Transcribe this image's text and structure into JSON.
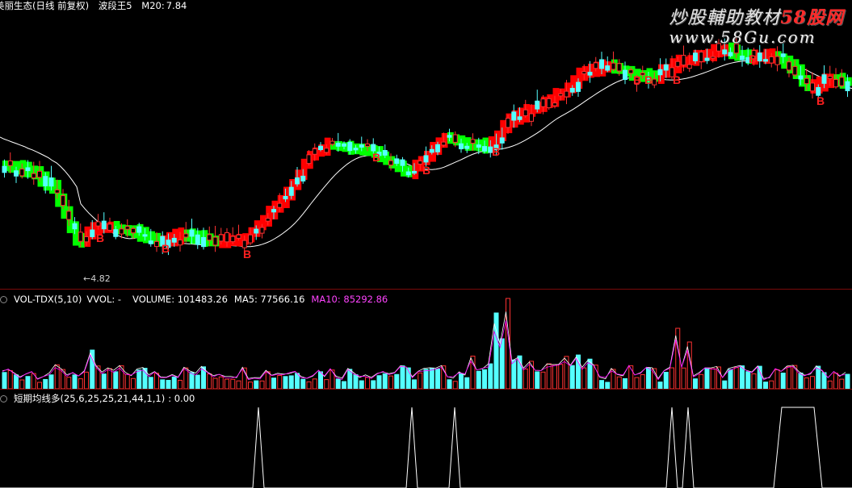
{
  "main_header": {
    "title": "美丽生态(日线 前复权)",
    "indicator": "波段王5",
    "ma_label": "M20:",
    "ma_value": "7.84"
  },
  "watermark": {
    "line1": "炒股輔助教材",
    "line1_accent": "58股网",
    "line2": "www.58Gu.com"
  },
  "price_annotation": {
    "low_label": "4.82"
  },
  "buy_marker_label": "B",
  "volume_header": {
    "name": "VOL-TDX(5,10)",
    "vvol": "VVOL: -",
    "volume": "VOLUME: 101483.26",
    "ma5": "MA5: 77566.16",
    "ma10": "MA10: 85292.86"
  },
  "indicator_header": {
    "name": "短期均线多(25,6,25,25,21,44,1,1)",
    "value": ": 0.00"
  },
  "colors": {
    "background": "#000000",
    "up_candle": "#ff3232",
    "down_candle": "#54ffff",
    "ribbon_up": "#ff0000",
    "ribbon_down": "#00ff00",
    "ma_line": "#ffffff",
    "ma10_line": "#ff00ff",
    "separator": "#7a0a0a"
  }
}
